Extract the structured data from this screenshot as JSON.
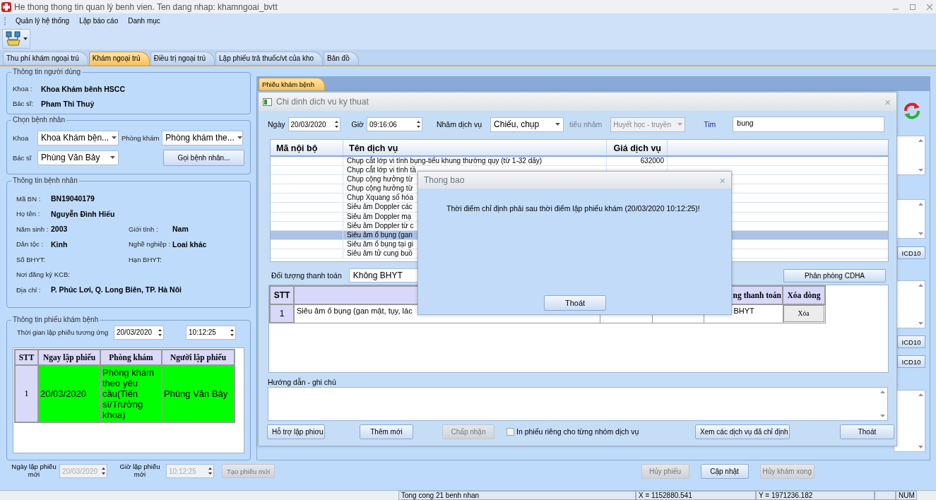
{
  "window": {
    "title": "He thong thong tin quan lý benh vien. Ten dang nhap: khamngoai_bvtt"
  },
  "menu": [
    "Quản lý hệ thống",
    "Lập báo cáo",
    "Danh mục"
  ],
  "tabs": [
    {
      "label": "Thu phí khám ngoại trú",
      "selected": false
    },
    {
      "label": "Khám ngoại trú",
      "selected": true
    },
    {
      "label": "Điều trị ngoại trú",
      "selected": false
    },
    {
      "label": "Lập phiếu trả thuốc/vt của kho",
      "selected": false
    },
    {
      "label": "Bản đồ",
      "selected": false
    }
  ],
  "user_info": {
    "title": "Thông tin người dùng",
    "fields": [
      {
        "label": "Khoa :",
        "value": "Khoa Khám bênh  HSCC"
      },
      {
        "label": "Bác sĩ:",
        "value": "Pham Thi Thuỷ"
      }
    ]
  },
  "patient_select": {
    "title": "Chọn bệnh nhân",
    "khoa_label": "Khoa",
    "khoa_value": "Khoa Khám bện...",
    "room_label": "Phòng khám",
    "room_value": "Phòng khám the...",
    "doctor_label": "Bác sĩ",
    "doctor_value": "Phùng Văn Bảy",
    "call_button": "Gọi bệnh nhân..."
  },
  "patient_info": {
    "title": "Thông tin bệnh nhân",
    "rows": [
      [
        {
          "label": "Mã BN :",
          "value": "BN19040179"
        }
      ],
      [
        {
          "label": "Họ tên :",
          "value": "Nguyễn Đình Hiếu"
        }
      ],
      [
        {
          "label": "Năm sinh :",
          "value": "2003"
        },
        {
          "label": "Giới tính :",
          "value": "Nam"
        }
      ],
      [
        {
          "label": "Dân tộc :",
          "value": "Kinh"
        },
        {
          "label": "Nghề nghiệp :",
          "value": "Loai khác"
        }
      ],
      [
        {
          "label": "Số BHYT:"
        },
        {
          "label": "Hạn BHYT:"
        }
      ],
      [
        {
          "label": "Nơi đăng ký KCB:"
        }
      ],
      [
        {
          "label": "Địa chỉ :",
          "value": "P. Phúc Lơi, Q. Long Biên, TP. Hà Nôi"
        }
      ]
    ]
  },
  "visit_info": {
    "title": "Thông tin phiếu khám bệnh",
    "time_label": "Thời gian lập phiếu tương ứng",
    "date": "20/03/2020",
    "time": "10:12:25",
    "columns": [
      "STT",
      "Ngay lập phiếu",
      "Phòng khám",
      "Người lập phiếu"
    ],
    "rows": [
      [
        "1",
        "20/03/2020",
        "Phòng khám theo yêu cầu(Tiến sĩ/Trưởng khoa)",
        "Phùng Văn Bảy"
      ]
    ]
  },
  "new_visit": {
    "date_label": "Ngày lập phiếu mới",
    "date": "20/03/2020",
    "time_label": "Giờ lập phiếu mới",
    "time": "10:12:25",
    "button": {
      "label": "Tạo phiếu mới",
      "disabled": true
    }
  },
  "exam_tab": {
    "label": "Phiếu khám bệnh",
    "selected": true
  },
  "icd_buttons": [
    "ICD10",
    "ICD10",
    "ICD10"
  ],
  "bottom_buttons": [
    {
      "label": "Hủy phiếu",
      "disabled": true
    },
    {
      "label": "Cập nhật",
      "disabled": false
    },
    {
      "label": "Hủy khám xong",
      "disabled": true
    }
  ],
  "service_dialog": {
    "title": "Chi dinh dich vu  ky thuat",
    "close_label": "×",
    "date_label": "Ngày",
    "date": "20/03/2020",
    "time_label": "Giờ",
    "time": "09:16:06",
    "group_label": "Nhâm dịch vụ",
    "group_value": "Chiếu, chụp",
    "subgroup_label": "tiểu nhâm",
    "subgroup_value": "Huyết học - truyền",
    "subgroup_disabled": true,
    "search_label": "Tim",
    "search_value": "bung",
    "columns": [
      "Mã nội bộ",
      "Tên dịch vụ",
      "Giá dịch vụ"
    ],
    "rows": [
      {
        "name": "Chụp cắt lớp vi tính bụng-tiểu khung thường quy (từ 1-32 dãy)",
        "price": "632000",
        "selected": false
      },
      {
        "name": "Chụp cắt lớp vi tính tầ",
        "selected": false
      },
      {
        "name": "Chụp cộng hưởng từ",
        "selected": false
      },
      {
        "name": "Chụp cộng hưởng từ",
        "selected": false
      },
      {
        "name": "Chụp Xquang số hóa",
        "selected": false
      },
      {
        "name": "Siêu âm Doppler các",
        "selected": false
      },
      {
        "name": "Siêu âm Doppler mạ",
        "selected": false
      },
      {
        "name": "Siêu âm Doppler từ c",
        "selected": false
      },
      {
        "name": "Siêu âm ổ bụng (gan",
        "selected": true
      },
      {
        "name": "Siêu âm ổ bụng tại gi",
        "selected": false
      },
      {
        "name": "Siêu âm tử cung buồ",
        "selected": false
      }
    ],
    "payer_label": "Đối tượng thanh toán",
    "payer_value": "Không BHYT",
    "assign_button": "Phân phòng CDHA",
    "order_columns": [
      "STT",
      "ng thanh toán",
      "Xóa dòng"
    ],
    "orders": [
      {
        "stt": "1",
        "name": "Siêu âm ổ bụng (gan mật, tụy, lác",
        "payer": "BHYT",
        "delete": "Xóa"
      }
    ],
    "notes_label": "Hướng dẫn - ghi chú",
    "buttons": [
      {
        "label": "Hỗ trợ lập phiơu",
        "disabled": false
      },
      {
        "label": "Thêm mới",
        "disabled": false
      },
      {
        "label": "Chấp nhận",
        "disabled": true
      }
    ],
    "separate_print": {
      "label": "In phiếu riêng cho từng nhóm dịch vụ",
      "checked": false
    },
    "view_button": "Xem các dịch vụ đã chỉ định",
    "close_button": "Thoát"
  },
  "message_box": {
    "title": "Thong bao",
    "close_label": "×",
    "message": "Thời điểm chỉ định phải sau thời điểm lập phiếu khám (20/03/2020 10:12:25)!",
    "button": "Thoát"
  },
  "status_bar": {
    "summary": "Tong cong 21 benh nhan",
    "x": "X = 1152880.541",
    "y": "Y = 1971236.182",
    "num": "NUM"
  }
}
